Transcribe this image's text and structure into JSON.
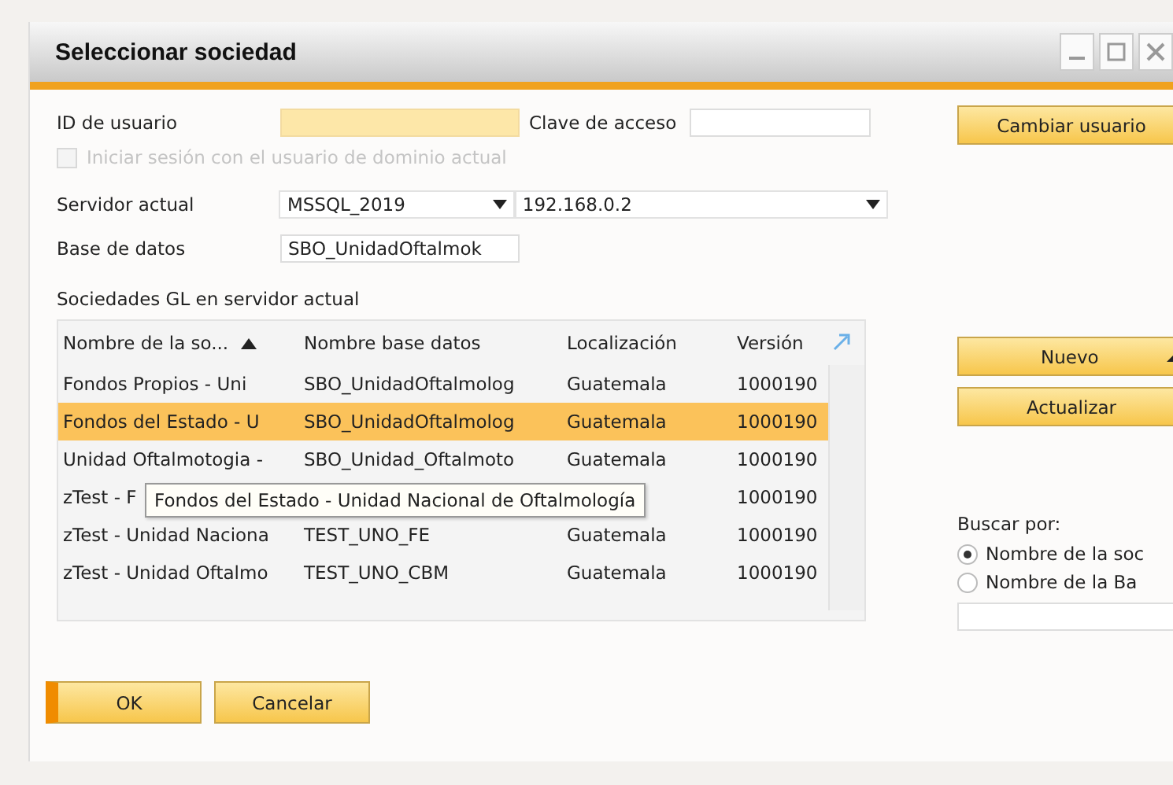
{
  "window": {
    "title": "Seleccionar sociedad"
  },
  "login": {
    "user_label": "ID de usuario",
    "password_label": "Clave de acceso",
    "domain_checkbox": {
      "label": "Iniciar sesión con el usuario de dominio actual",
      "checked": false,
      "disabled": true
    },
    "change_user_button": "Cambiar usuario"
  },
  "server": {
    "label": "Servidor actual",
    "type": "MSSQL_2019",
    "address": "192.168.0.2"
  },
  "database": {
    "label": "Base de datos",
    "value": "SBO_UnidadOftalmok"
  },
  "table": {
    "caption": "Sociedades GL en servidor actual",
    "columns": [
      "Nombre de la so...",
      "Nombre base datos",
      "Localización",
      "Versión"
    ],
    "rows": [
      {
        "name": "Fondos  Propios -  Uni",
        "database": "SBO_UnidadOftalmolog",
        "localization": "Guatemala",
        "version": "1000190",
        "selected": false
      },
      {
        "name": "Fondos del Estado - U",
        "database": "SBO_UnidadOftalmolog",
        "localization": "Guatemala",
        "version": "1000190",
        "selected": true
      },
      {
        "name": "Unidad Oftalmotogia -",
        "database": "SBO_Unidad_Oftalmoto",
        "localization": "Guatemala",
        "version": "1000190",
        "selected": false
      },
      {
        "name": "zTest - F",
        "version": "1000190",
        "selected": false
      },
      {
        "name": "zTest - Unidad Naciona",
        "database": "TEST_UNO_FE",
        "localization": "Guatemala",
        "version": "1000190",
        "selected": false
      },
      {
        "name": "zTest - Unidad Oftalmo",
        "database": "TEST_UNO_CBM",
        "localization": "Guatemala",
        "version": "1000190",
        "selected": false
      }
    ],
    "tooltip": "Fondos del Estado - Unidad Nacional de Oftalmología"
  },
  "side": {
    "new_button": "Nuevo",
    "refresh_button": "Actualizar",
    "search_label": "Buscar por:",
    "search_options": [
      {
        "label": "Nombre de la soc",
        "selected": true
      },
      {
        "label": "Nombre de la Ba",
        "selected": false
      }
    ]
  },
  "buttons": [
    {
      "label": "OK",
      "default": true
    },
    {
      "label": "Cancelar",
      "default": false
    }
  ]
}
